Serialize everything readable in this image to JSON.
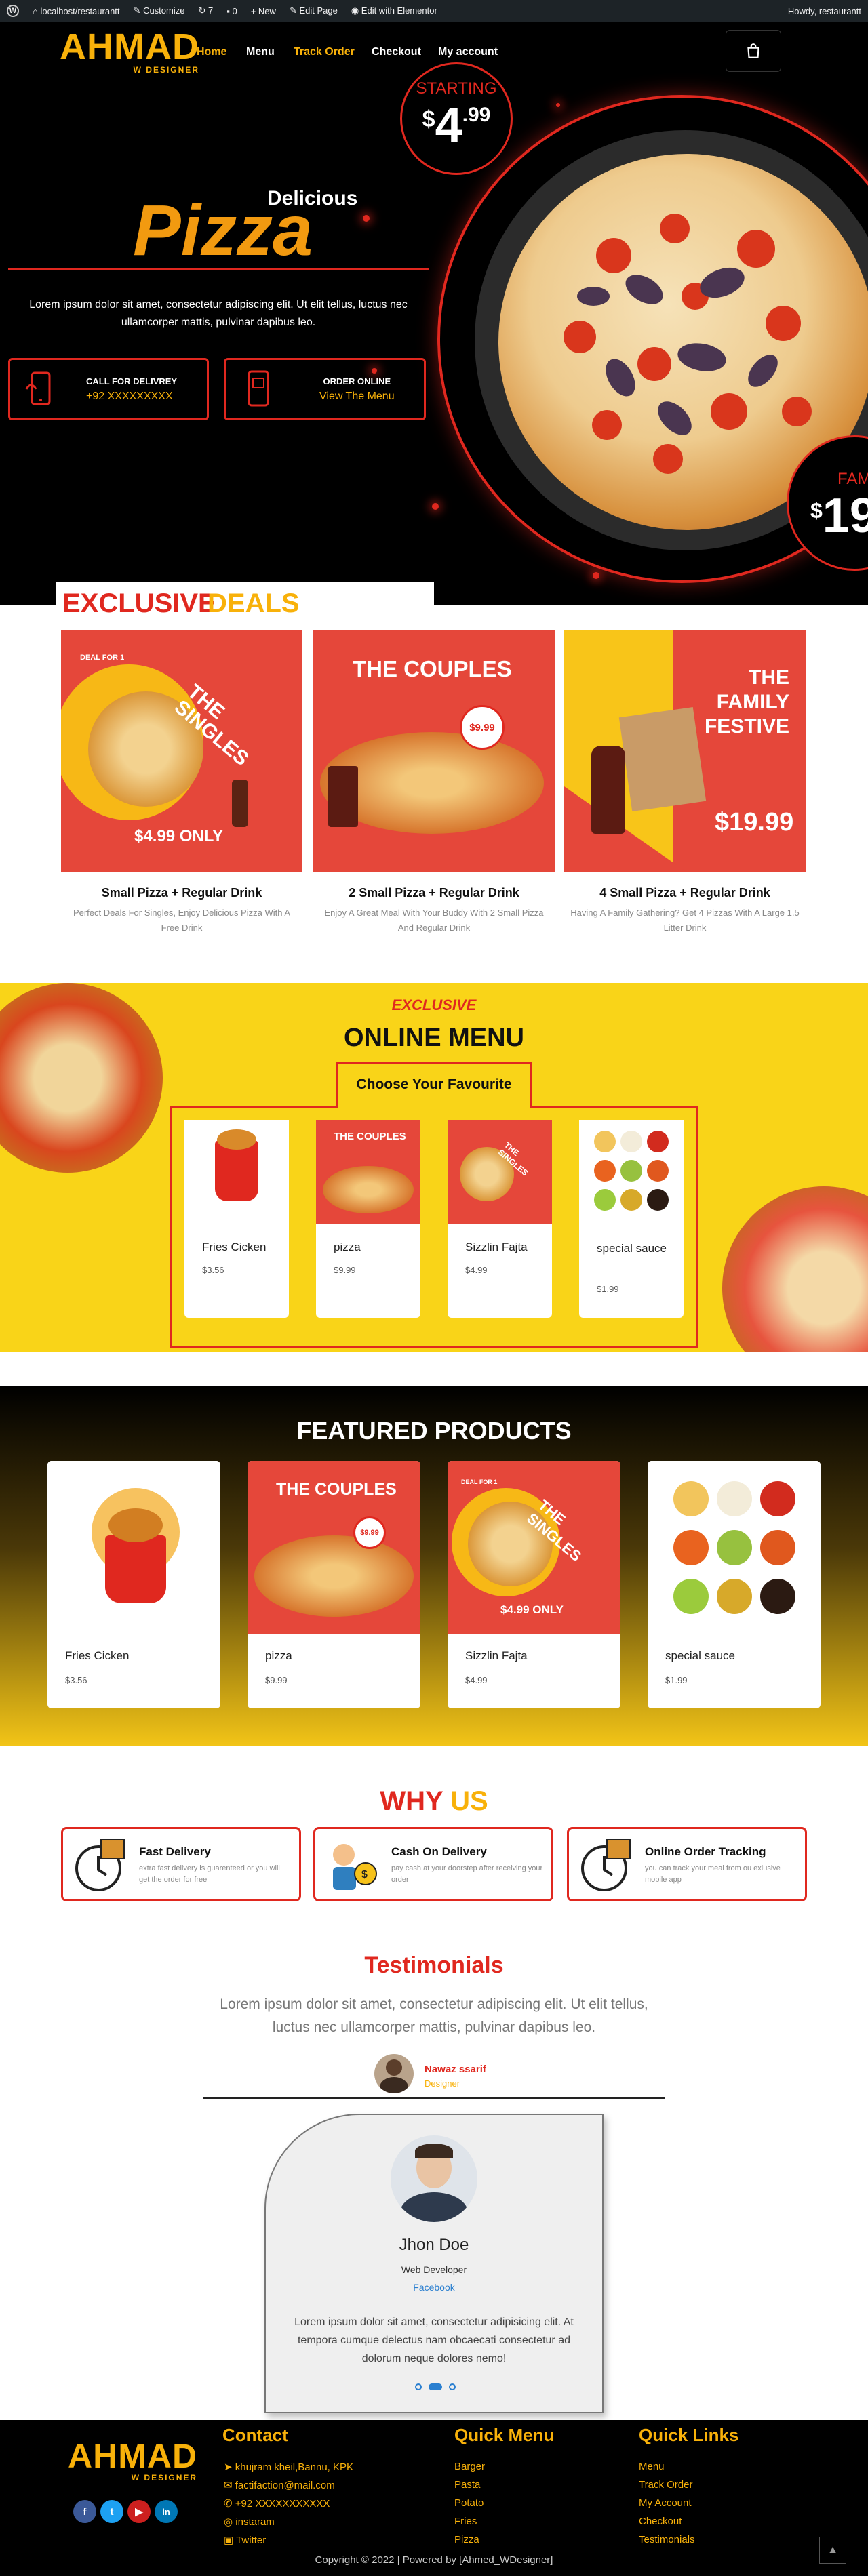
{
  "adminbar": {
    "site": "localhost/restaurantt",
    "customize": "Customize",
    "updates": "7",
    "comments": "0",
    "new": "New",
    "edit_page": "Edit Page",
    "elementor": "Edit with Elementor",
    "howdy": "Howdy, restaurantt"
  },
  "header": {
    "logo_main": "AHMAD",
    "logo_sub": "W DESIGNER",
    "nav": [
      "Home",
      "Menu",
      "Track Order",
      "Checkout",
      "My account"
    ]
  },
  "hero": {
    "delicious": "Delicious",
    "pizza": "Pizza",
    "lorem": "Lorem ipsum dolor sit amet, consectetur adipiscing elit. Ut elit tellus, luctus nec ullamcorper mattis, pulvinar dapibus leo.",
    "btn1_t1": "CALL FOR DELIVREY",
    "btn1_t2": "+92 XXXXXXXXX",
    "btn2_t1": "ORDER ONLINE",
    "btn2_t2": "View The Menu",
    "starting": "STARTING",
    "price_cur": "$",
    "price_int": "4",
    "price_dec": ".99",
    "fam": "FAM",
    "price2_cur": "$",
    "price2": "19"
  },
  "deals": {
    "title_red": "EXCLUSIVE",
    "title_yellow": "DEALS",
    "cards": [
      {
        "img_top": "DEAL FOR 1",
        "img_title": "THE SINGLES",
        "img_price": "$4.99 ONLY",
        "title": "Small Pizza + Regular Drink",
        "desc": "Perfect Deals For Singles, Enjoy Delicious Pizza With A Free Drink"
      },
      {
        "img_title": "THE COUPLES",
        "img_price": "$9.99",
        "title": "2 Small Pizza + Regular Drink",
        "desc": "Enjoy A Great Meal With Your Buddy With 2 Small Pizza And Regular Drink"
      },
      {
        "img_title_1": "THE",
        "img_title_2": "FAMILY",
        "img_title_3": "FESTIVE",
        "img_price": "$19.99",
        "title": "4 Small Pizza + Regular Drink",
        "desc": "Having A Family Gathering? Get 4 Pizzas With A Large 1.5 Litter Drink"
      }
    ]
  },
  "online_menu": {
    "exclusive": "EXCLUSIVE",
    "title": "ONLINE MENU",
    "subtitle": "Choose Your Favourite",
    "items": [
      {
        "name": "Fries Cicken",
        "price": "$3.56"
      },
      {
        "name": "pizza",
        "price": "$9.99"
      },
      {
        "name": "Sizzlin Fajta",
        "price": "$4.99"
      },
      {
        "name": "special sauce",
        "price": "$1.99"
      }
    ]
  },
  "featured": {
    "title": "FEATURED PRODUCTS",
    "items": [
      {
        "name": "Fries Cicken",
        "price": "$3.56"
      },
      {
        "name": "pizza",
        "price": "$9.99"
      },
      {
        "name": "Sizzlin Fajta",
        "price": "$4.99"
      },
      {
        "name": "special sauce",
        "price": "$1.99"
      }
    ]
  },
  "why": {
    "title_red": "WHY",
    "title_yellow": "US",
    "items": [
      {
        "title": "Fast Delivery",
        "desc": "extra fast delivery is guarenteed or you will get the order for free"
      },
      {
        "title": "Cash On Delivery",
        "desc": "pay cash at your doorstep after receiving your order"
      },
      {
        "title": "Online Order Tracking",
        "desc": "you can track your meal from ou exlusive mobile app"
      }
    ]
  },
  "testimonials": {
    "title": "Testimonials",
    "lorem": "Lorem ipsum dolor sit amet, consectetur adipiscing elit. Ut elit tellus, luctus nec ullamcorper mattis, pulvinar dapibus leo.",
    "author_name": "Nawaz ssarif",
    "author_role": "Designer",
    "card_name": "Jhon Doe",
    "card_role": "Web Developer",
    "card_link": "Facebook",
    "card_text": "Lorem ipsum dolor sit amet, consectetur adipisicing elit. At tempora cumque delectus nam obcaecati consectetur ad dolorum neque dolores nemo!"
  },
  "footer": {
    "logo_main": "AHMAD",
    "logo_sub": "W DESIGNER",
    "contact_title": "Contact",
    "contact": [
      "khujram kheil,Bannu, KPK",
      "factifaction@mail.com",
      "+92 XXXXXXXXXXX",
      "instaram",
      "Twitter"
    ],
    "quick_menu_title": "Quick Menu",
    "quick_menu": [
      "Barger",
      "Pasta",
      "Potato",
      "Fries",
      "Pizza"
    ],
    "quick_links_title": "Quick Links",
    "quick_links": [
      "Menu",
      "Track Order",
      "My Account",
      "Checkout",
      "Testimonials"
    ],
    "copyright": "Copyright © 2022 | Powered by [Ahmed_WDesigner]"
  },
  "colors": {
    "red": "#e0281f",
    "yellow": "#f8b10a",
    "deal_bg": "#e5473a",
    "menu_bg": "#f9d418"
  }
}
